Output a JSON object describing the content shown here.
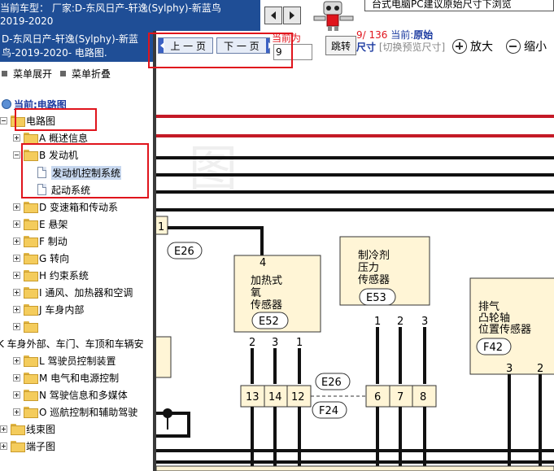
{
  "header": {
    "title_line1": "当前车型：  厂家:D-东风日产-轩逸(Sylphy)-新蓝鸟",
    "title_line2": "2019-2020",
    "promo_text": "台式电脑PC建议原始尺寸下浏览",
    "prev_arrow_icon": "left-arrow-icon",
    "next_arrow_icon": "right-arrow-icon"
  },
  "left_panel": {
    "header_line1": "D-东风日产-轩逸(Sylphy)-新蓝",
    "header_line2": "鸟-2019-2020- 电路图.",
    "expand_all": "菜单展开",
    "collapse_all": "菜单折叠",
    "current_label": "当前:电路图"
  },
  "tree": {
    "root": "电路图",
    "items": [
      {
        "label": "A 概述信息",
        "expanded": false
      },
      {
        "label": "B 发动机",
        "expanded": true,
        "children": [
          "发动机控制系统",
          "起动系统"
        ],
        "selected": "发动机控制系统"
      },
      {
        "label": "D 变速箱和传动系",
        "expanded": false
      },
      {
        "label": "E 悬架",
        "expanded": false
      },
      {
        "label": "F 制动",
        "expanded": false
      },
      {
        "label": "G 转向",
        "expanded": false
      },
      {
        "label": "H 约束系统",
        "expanded": false
      },
      {
        "label": "I 通风、加热器和空调",
        "expanded": false
      },
      {
        "label": "J 车身内部",
        "expanded": false
      },
      {
        "label": "",
        "expanded": false
      },
      {
        "label": "K 车身外部、车门、车顶和车辆安",
        "expanded": false
      },
      {
        "label": "L 驾驶员控制装置",
        "expanded": false
      },
      {
        "label": "M 电气和电源控制",
        "expanded": false
      },
      {
        "label": "N 驾驶信息和多媒体",
        "expanded": false
      },
      {
        "label": "O 巡航控制和辅助驾驶",
        "expanded": false
      }
    ],
    "bottom_items": [
      "线束图",
      "端子图"
    ]
  },
  "toolbar": {
    "prev_page": "上 一 页",
    "next_page": "下 一 页",
    "page_label": "当前为",
    "page_value": "9",
    "jump": "跳转",
    "page_current": "9",
    "page_total": "/ 136",
    "current_text": "当前:",
    "original_text": "原始",
    "size_text": "尺寸",
    "switch_preview": "[切换预览尺寸]",
    "zoom_in": "放大",
    "zoom_out": "缩小",
    "zoom_in_icon": "zoom-in-icon",
    "zoom_out_icon": "zoom-out-icon"
  },
  "diagram": {
    "watermark": "图",
    "connector_e26": "E26",
    "connector_f24": "F24",
    "connector_e26b": "E26",
    "frag_pin": "1",
    "sensor1": {
      "name_line1": "加热式",
      "name_line2": "氧",
      "name_line3": "传感器",
      "code": "E52",
      "top_pin": "4",
      "pins": [
        "2",
        "3",
        "1"
      ]
    },
    "sensor2": {
      "name_line1": "制冷剂",
      "name_line2": "压力",
      "name_line3": "传感器",
      "code": "E53",
      "pins": [
        "1",
        "2",
        "3"
      ]
    },
    "sensor3": {
      "name_line1": "排气",
      "name_line2": "凸轮轴",
      "name_line3": "位置传感器",
      "code": "F42",
      "pins": [
        "3",
        "2"
      ]
    },
    "junction_left": [
      "13",
      "14",
      "12"
    ],
    "junction_right": [
      "6",
      "7",
      "8"
    ]
  }
}
